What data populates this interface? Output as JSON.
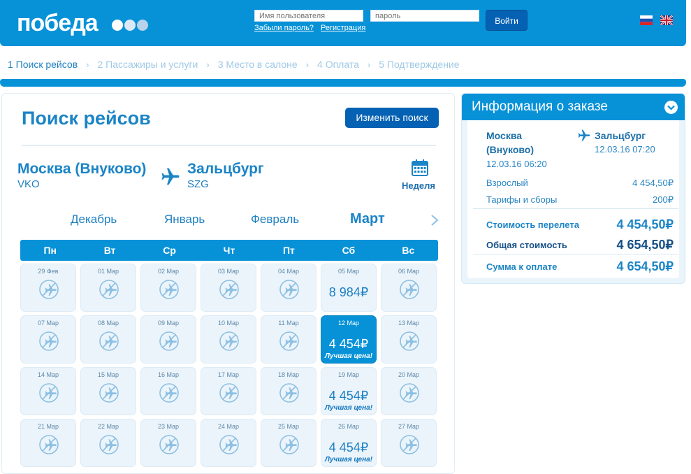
{
  "header": {
    "logo_text": "победа",
    "username_placeholder": "Имя пользователя",
    "password_placeholder": "пароль",
    "forgot_password": "Забыли пароль?",
    "register": "Регистрация",
    "login_button": "Войти",
    "colors": {
      "brand": "#0792d8",
      "button": "#0561b3"
    },
    "languages": [
      "ru",
      "en"
    ]
  },
  "steps": [
    "1 Поиск рейсов",
    "2 Пассажиры и услуги",
    "3 Место в салоне",
    "4 Оплата",
    "5 Подтверждение"
  ],
  "search": {
    "title": "Поиск рейсов",
    "change_button": "Изменить поиск",
    "from_city": "Москва (Внуково)",
    "from_code": "VKO",
    "to_city": "Зальцбург",
    "to_code": "SZG",
    "week_label": "Неделя",
    "months": [
      "Декабрь",
      "Январь",
      "Февраль",
      "Март"
    ],
    "active_month": "Март",
    "weekdays": [
      "Пн",
      "Вт",
      "Ср",
      "Чт",
      "Пт",
      "Сб",
      "Вс"
    ],
    "weeks": [
      [
        "29 Фев",
        "01 Мар",
        "02 Мар",
        "03 Мар",
        "04 Мар",
        "05 Мар",
        "06 Мар"
      ],
      [
        "07 Мар",
        "08 Мар",
        "09 Мар",
        "10 Мар",
        "11 Мар",
        "12 Мар",
        "13 Мар"
      ],
      [
        "14 Мар",
        "15 Мар",
        "16 Мар",
        "17 Мар",
        "18 Мар",
        "19 Мар",
        "20 Мар"
      ],
      [
        "21 Мар",
        "22 Мар",
        "23 Мар",
        "24 Мар",
        "25 Мар",
        "26 Мар",
        "27 Мар"
      ]
    ],
    "prices": {
      "05 Мар": "8 984₽",
      "12 Мар": "4 454₽",
      "19 Мар": "4 454₽",
      "26 Мар": "4 454₽"
    },
    "best_price_label": "Лучшая цена!",
    "best_price_days": [
      "12 Мар",
      "19 Мар",
      "26 Мар"
    ],
    "selected_day": "12 Мар"
  },
  "order": {
    "title": "Информация о заказе",
    "from_line1": "Москва",
    "from_line2": "(Внуково)",
    "from_datetime": "12.03.16 06:20",
    "to_city": "Зальцбург",
    "to_datetime": "12.03.16 07:20",
    "adult_label": "Взрослый",
    "adult_amount": "4 454,50₽",
    "fees_label": "Тарифы и сборы",
    "fees_amount": "200₽",
    "flight_cost_label": "Стоимость перелета",
    "flight_cost_amount": "4 454,50₽",
    "total_label": "Общая стоимость",
    "total_amount": "4 654,50₽",
    "pay_label": "Сумма к оплате",
    "pay_amount": "4 654,50₽"
  }
}
